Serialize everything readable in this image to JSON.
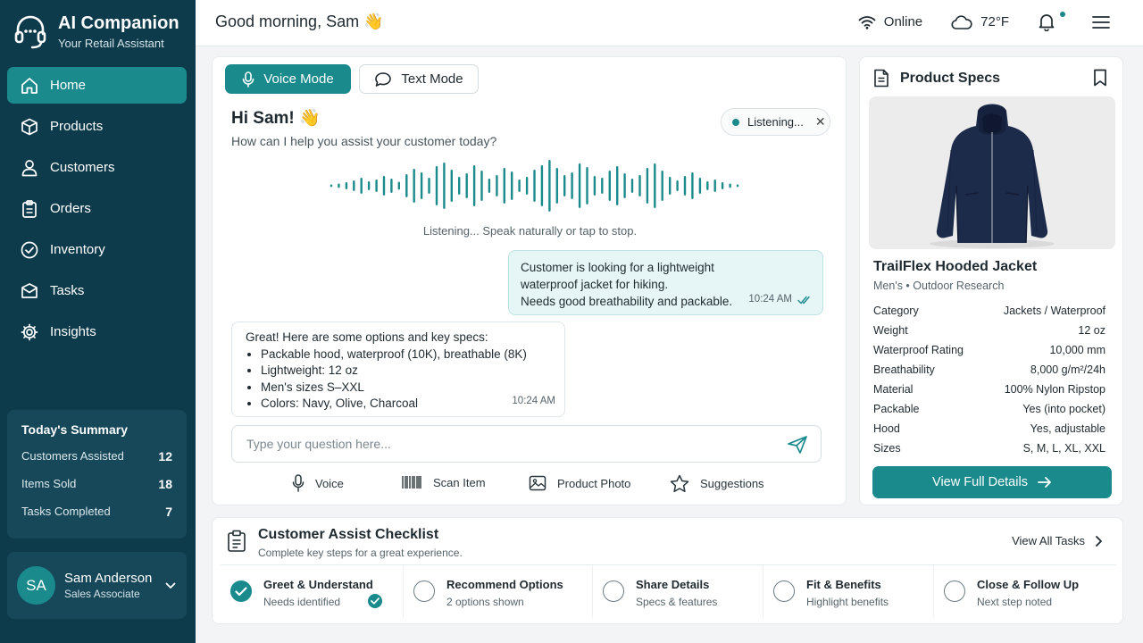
{
  "brand": {
    "title": "AI Companion",
    "subtitle": "Your Retail Assistant"
  },
  "nav": [
    {
      "label": "Home",
      "icon": "home-icon",
      "active": true
    },
    {
      "label": "Products",
      "icon": "box-icon"
    },
    {
      "label": "Customers",
      "icon": "user-icon"
    },
    {
      "label": "Orders",
      "icon": "clipboard-icon"
    },
    {
      "label": "Inventory",
      "icon": "check-circle-icon"
    },
    {
      "label": "Tasks",
      "icon": "mail-icon"
    },
    {
      "label": "Insights",
      "icon": "gear-icon"
    }
  ],
  "summary": {
    "title": "Today's Summary",
    "rows": [
      {
        "label": "Customers Assisted",
        "value": "12"
      },
      {
        "label": "Items Sold",
        "value": "18"
      },
      {
        "label": "Tasks Completed",
        "value": "7"
      }
    ]
  },
  "user": {
    "initials": "SA",
    "name": "Sam Anderson",
    "role": "Sales Associate"
  },
  "topbar": {
    "greeting": "Good morning, Sam 👋",
    "status": "Online",
    "weather": "72°F"
  },
  "chat": {
    "voice_mode": "Voice Mode",
    "text_mode": "Text Mode",
    "hi": "Hi Sam! 👋",
    "hi_sub": "How can I help you assist your customer today?",
    "listening_pill": "Listening...",
    "close_glyph": "✕",
    "wave_caption": "Listening... Speak naturally or tap to stop.",
    "outgoing": {
      "lines": [
        "Customer is looking for a lightweight",
        "waterproof jacket for hiking.",
        "Needs good breathability and packable."
      ],
      "time": "10:24 AM"
    },
    "incoming": {
      "intro": "Great! Here are some options and key specs:",
      "bullets": [
        "Packable hood, waterproof (10K), breathable (8K)",
        "Lightweight: 12 oz",
        "Men's sizes S–XXL",
        "Colors: Navy, Olive, Charcoal"
      ],
      "time": "10:24 AM"
    },
    "input_placeholder": "Type your question here...",
    "tools": [
      {
        "label": "Voice",
        "icon": "microphone-icon"
      },
      {
        "label": "Scan Item",
        "icon": "barcode-icon"
      },
      {
        "label": "Product Photo",
        "icon": "image-icon"
      },
      {
        "label": "Suggestions",
        "icon": "star-icon"
      }
    ]
  },
  "specs": {
    "title": "Product Specs",
    "product_name": "TrailFlex Hooded Jacket",
    "product_meta": "Men's • Outdoor Research",
    "rows": [
      {
        "label": "Category",
        "value": "Jackets / Waterproof"
      },
      {
        "label": "Weight",
        "value": "12 oz"
      },
      {
        "label": "Waterproof Rating",
        "value": "10,000 mm"
      },
      {
        "label": "Breathability",
        "value": "8,000 g/m²/24h"
      },
      {
        "label": "Material",
        "value": "100% Nylon Ripstop"
      },
      {
        "label": "Packable",
        "value": "Yes (into pocket)"
      },
      {
        "label": "Hood",
        "value": "Yes, adjustable"
      },
      {
        "label": "Sizes",
        "value": "S, M, L, XL, XXL"
      }
    ],
    "button": "View Full Details"
  },
  "checklist": {
    "title": "Customer Assist Checklist",
    "subtitle": "Complete key steps for a great experience.",
    "view_all": "View All Tasks",
    "steps": [
      {
        "title": "Greet & Understand",
        "desc": "Needs identified",
        "done": true
      },
      {
        "title": "Recommend Options",
        "desc": "2 options shown",
        "done": false
      },
      {
        "title": "Share Details",
        "desc": "Specs & features",
        "done": false
      },
      {
        "title": "Fit & Benefits",
        "desc": "Highlight benefits",
        "done": false
      },
      {
        "title": "Close & Follow Up",
        "desc": "Next step noted",
        "done": false
      }
    ]
  },
  "colors": {
    "sidebar": "#0d3b4c",
    "accent": "#1a8a8c",
    "background": "#f2f4f5"
  }
}
